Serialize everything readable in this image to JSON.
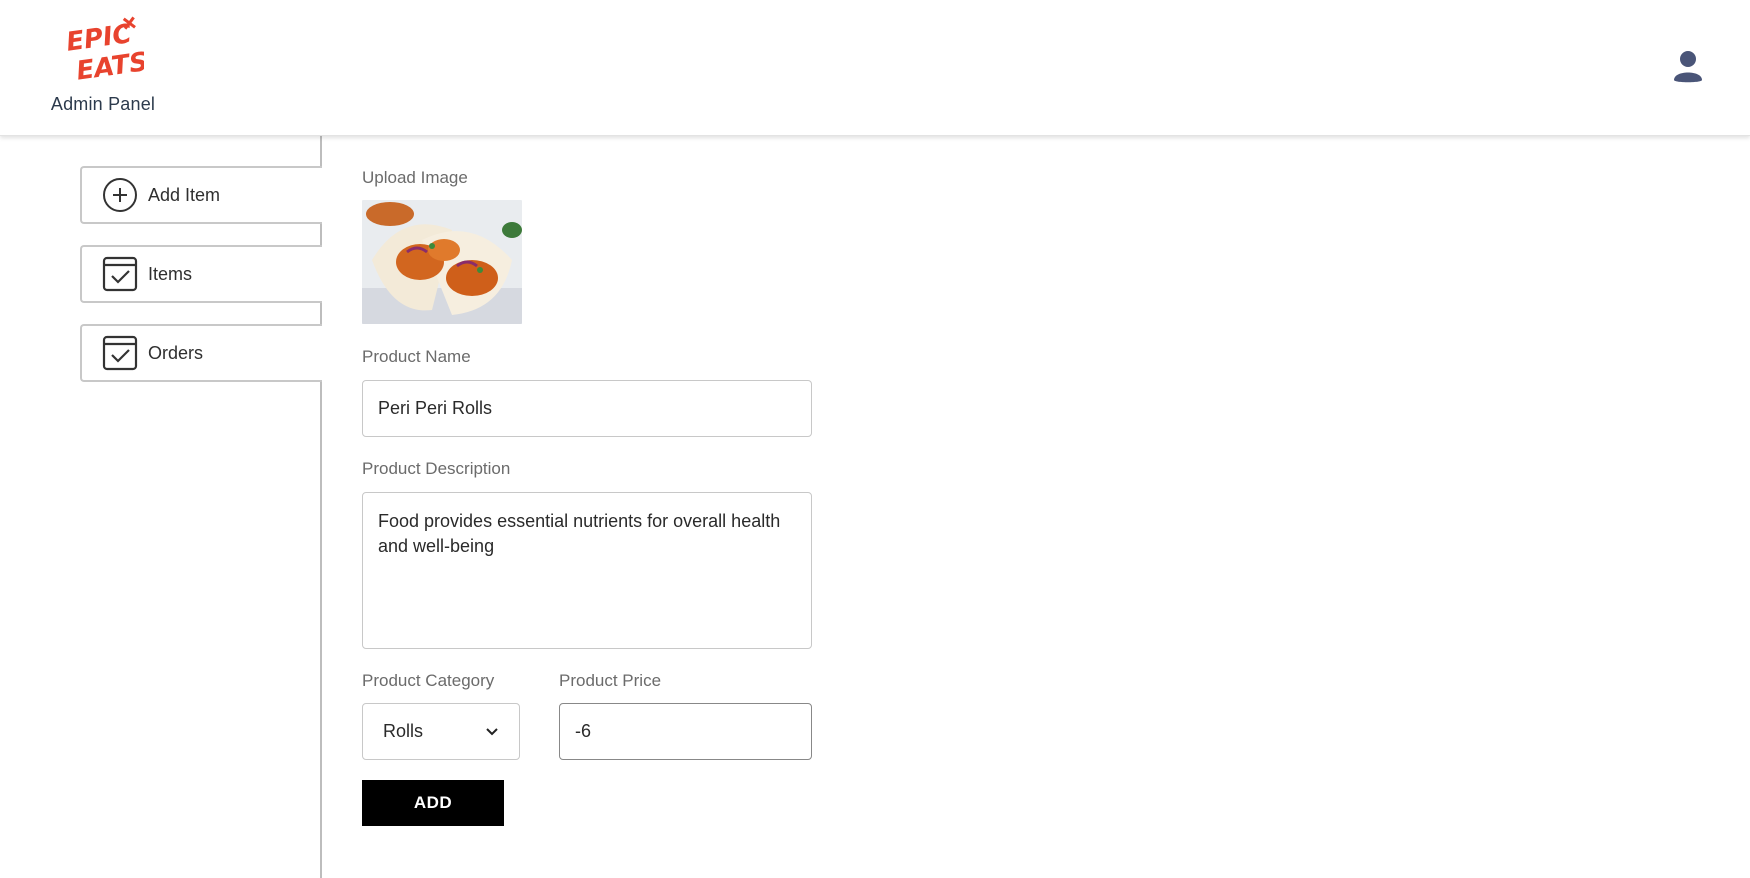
{
  "header": {
    "logo_text": "EPIC EATS",
    "subtitle": "Admin Panel",
    "profile_icon": "user-icon"
  },
  "sidebar": {
    "items": [
      {
        "label": "Add Item",
        "icon": "plus-circle-icon"
      },
      {
        "label": "Items",
        "icon": "checkbox-calendar-icon"
      },
      {
        "label": "Orders",
        "icon": "checkbox-calendar-icon"
      }
    ]
  },
  "form": {
    "upload_label": "Upload Image",
    "name_label": "Product Name",
    "name_value": "Peri Peri Rolls",
    "description_label": "Product Description",
    "description_value": "Food provides essential nutrients for overall health and well-being",
    "category_label": "Product Category",
    "category_value": "Rolls",
    "price_label": "Product Price",
    "price_value": "-6",
    "add_label": "ADD"
  },
  "colors": {
    "logo_red": "#e8432e",
    "button_bg": "#000000",
    "profile": "#4a5578"
  }
}
